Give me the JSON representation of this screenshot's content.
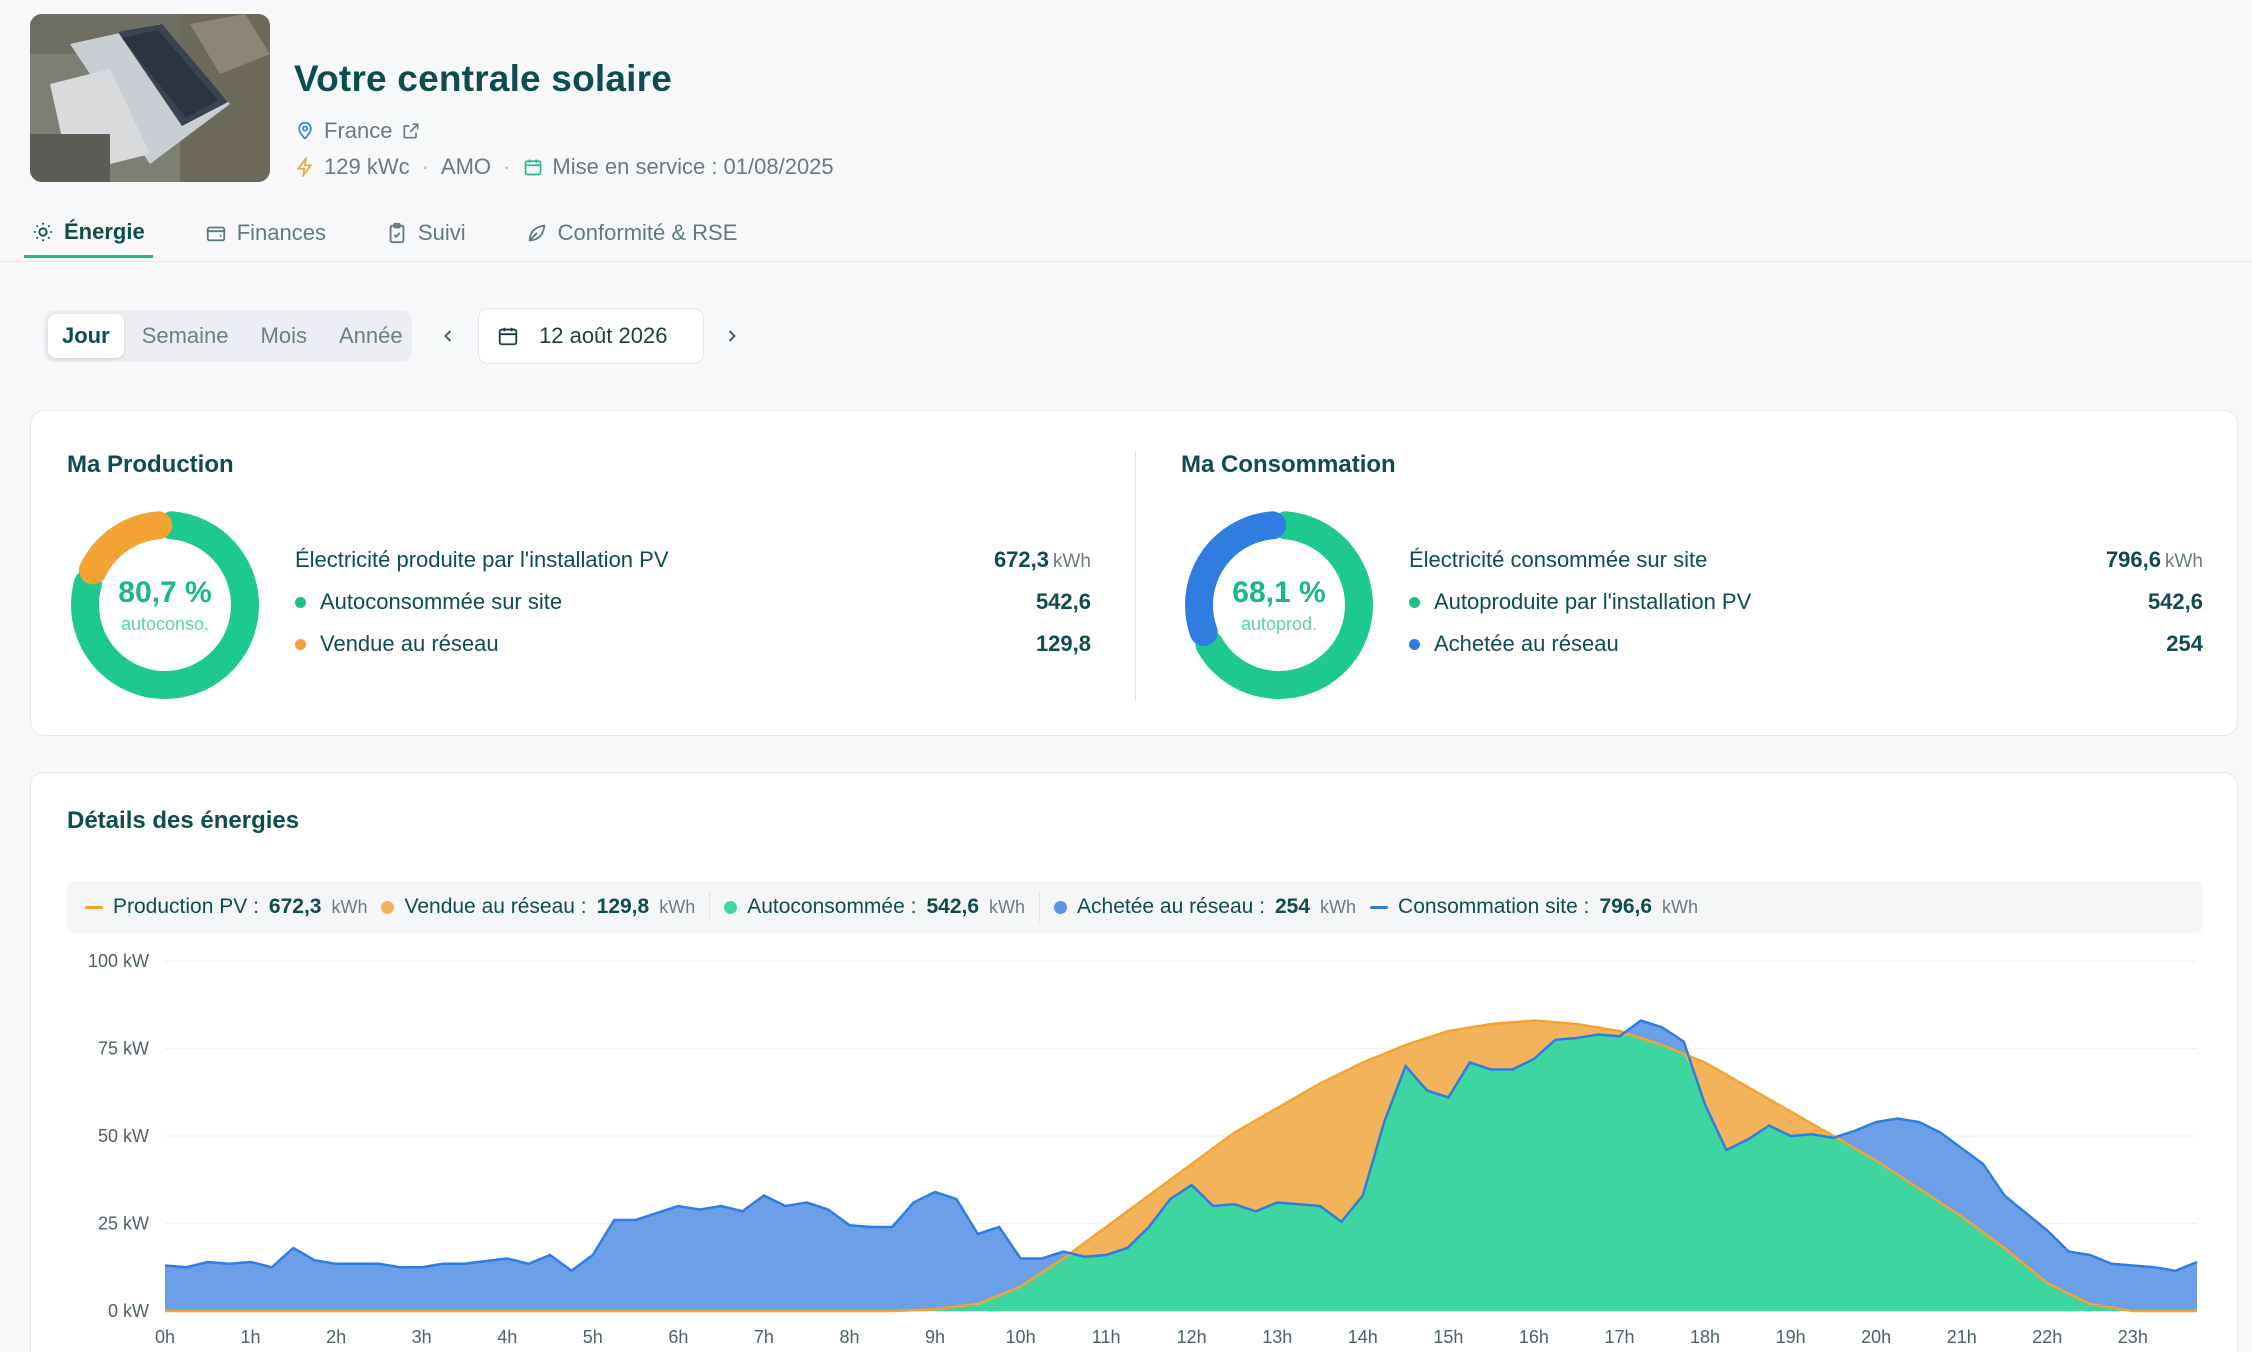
{
  "header": {
    "title": "Votre centrale solaire",
    "location": "France",
    "power": "129 kWc",
    "role": "AMO",
    "commissioning": "Mise en service : 01/08/2025"
  },
  "tabs": [
    {
      "label": "Énergie",
      "icon": "sun-icon",
      "active": true
    },
    {
      "label": "Finances",
      "icon": "wallet-icon",
      "active": false
    },
    {
      "label": "Suivi",
      "icon": "clipboard-check-icon",
      "active": false
    },
    {
      "label": "Conformité & RSE",
      "icon": "leaf-icon",
      "active": false
    }
  ],
  "period": {
    "options": [
      "Jour",
      "Semaine",
      "Mois",
      "Année"
    ],
    "selected": "Jour",
    "date": "12 août 2026"
  },
  "production": {
    "title": "Ma Production",
    "percent": "80,7 %",
    "percent_sub": "autoconso.",
    "ratio": 0.807,
    "total_label": "Électricité produite par l'installation PV",
    "total_value": "672,3",
    "total_unit": "kWh",
    "rows": [
      {
        "label": "Autoconsommée sur site",
        "value": "542,6",
        "color": "#1dbf86"
      },
      {
        "label": "Vendue au réseau",
        "value": "129,8",
        "color": "#f2a333"
      }
    ]
  },
  "consumption": {
    "title": "Ma Consommation",
    "percent": "68,1 %",
    "percent_sub": "autoprod.",
    "ratio": 0.681,
    "total_label": "Électricité consommée sur site",
    "total_value": "796,6",
    "total_unit": "kWh",
    "rows": [
      {
        "label": "Autoproduite par l'installation PV",
        "value": "542,6",
        "color": "#1dbf86"
      },
      {
        "label": "Achetée au réseau",
        "value": "254",
        "color": "#2f7de1"
      }
    ]
  },
  "details": {
    "title": "Détails des énergies",
    "legend": [
      {
        "label": "Production PV :",
        "value": "672,3",
        "unit": "kWh",
        "color": "#f2a333",
        "shape": "line"
      },
      {
        "label": "Vendue au réseau :",
        "value": "129,8",
        "unit": "kWh",
        "color": "#f2b35a",
        "shape": "dot"
      },
      {
        "label": "Autoconsommée :",
        "value": "542,6",
        "unit": "kWh",
        "color": "#3dd6a0",
        "shape": "dot"
      },
      {
        "label": "Achetée au réseau :",
        "value": "254",
        "unit": "kWh",
        "color": "#5b93e6",
        "shape": "dot"
      },
      {
        "label": "Consommation site :",
        "value": "796,6",
        "unit": "kWh",
        "color": "#2f7de1",
        "shape": "line"
      }
    ]
  },
  "chart_data": {
    "type": "area",
    "x_labels": [
      "0h",
      "1h",
      "2h",
      "3h",
      "4h",
      "5h",
      "6h",
      "7h",
      "8h",
      "9h",
      "10h",
      "11h",
      "12h",
      "13h",
      "14h",
      "15h",
      "16h",
      "17h",
      "18h",
      "19h",
      "20h",
      "21h",
      "22h",
      "23h"
    ],
    "y_ticks": [
      "0 kW",
      "25 kW",
      "50 kW",
      "75 kW",
      "100 kW"
    ],
    "ylim": [
      0,
      100
    ],
    "x_range": [
      0,
      23.75
    ],
    "grid": true,
    "series": [
      {
        "name": "Consommation site",
        "color": "#2f7de1",
        "fill": "#6b9fe8",
        "points": [
          [
            0,
            13
          ],
          [
            0.25,
            12.5
          ],
          [
            0.5,
            14
          ],
          [
            0.75,
            13.5
          ],
          [
            1,
            14
          ],
          [
            1.25,
            12.5
          ],
          [
            1.5,
            18
          ],
          [
            1.75,
            14.5
          ],
          [
            2,
            13.5
          ],
          [
            2.5,
            13.5
          ],
          [
            2.75,
            12.5
          ],
          [
            3,
            12.5
          ],
          [
            3.25,
            13.5
          ],
          [
            3.5,
            13.5
          ],
          [
            4,
            15
          ],
          [
            4.25,
            13.5
          ],
          [
            4.5,
            16
          ],
          [
            4.75,
            11.5
          ],
          [
            5,
            16
          ],
          [
            5.25,
            26
          ],
          [
            5.5,
            26
          ],
          [
            5.75,
            28
          ],
          [
            6,
            30
          ],
          [
            6.25,
            29
          ],
          [
            6.5,
            30
          ],
          [
            6.75,
            28.5
          ],
          [
            7,
            33
          ],
          [
            7.25,
            30
          ],
          [
            7.5,
            31
          ],
          [
            7.75,
            29
          ],
          [
            8,
            24.5
          ],
          [
            8.25,
            24
          ],
          [
            8.5,
            24
          ],
          [
            8.75,
            31
          ],
          [
            9,
            34
          ],
          [
            9.25,
            32
          ],
          [
            9.5,
            22
          ],
          [
            9.75,
            24
          ],
          [
            10,
            15
          ],
          [
            10.25,
            15
          ],
          [
            10.5,
            17
          ],
          [
            10.75,
            15.5
          ],
          [
            11,
            16
          ],
          [
            11.25,
            18
          ],
          [
            11.5,
            24
          ],
          [
            11.75,
            32
          ],
          [
            12,
            36
          ],
          [
            12.25,
            30
          ],
          [
            12.5,
            30.5
          ],
          [
            12.75,
            28.5
          ],
          [
            13,
            31
          ],
          [
            13.25,
            30.5
          ],
          [
            13.5,
            30
          ],
          [
            13.75,
            25.5
          ],
          [
            14,
            33
          ],
          [
            14.25,
            54
          ],
          [
            14.5,
            70
          ],
          [
            14.75,
            63
          ],
          [
            15,
            61
          ],
          [
            15.25,
            71
          ],
          [
            15.5,
            69
          ],
          [
            15.75,
            69
          ],
          [
            16,
            72
          ],
          [
            16.25,
            77.5
          ],
          [
            16.5,
            78
          ],
          [
            16.75,
            79
          ],
          [
            17,
            78.5
          ],
          [
            17.25,
            83
          ],
          [
            17.5,
            81
          ],
          [
            17.75,
            77
          ],
          [
            18,
            59
          ],
          [
            18.25,
            46
          ],
          [
            18.5,
            49
          ],
          [
            18.75,
            53
          ],
          [
            19,
            50
          ],
          [
            19.25,
            50.5
          ],
          [
            19.5,
            49.5
          ],
          [
            19.75,
            51.5
          ],
          [
            20,
            54
          ],
          [
            20.25,
            55
          ],
          [
            20.5,
            54
          ],
          [
            20.75,
            51
          ],
          [
            21,
            46.5
          ],
          [
            21.25,
            42
          ],
          [
            21.5,
            33
          ],
          [
            21.75,
            28
          ],
          [
            22,
            23
          ],
          [
            22.25,
            17
          ],
          [
            22.5,
            16
          ],
          [
            22.75,
            13.5
          ],
          [
            23,
            13
          ],
          [
            23.25,
            12.5
          ],
          [
            23.5,
            11.5
          ],
          [
            23.75,
            14
          ],
          [
            24,
            13.5
          ]
        ]
      },
      {
        "name": "Production PV",
        "color": "#f2a333",
        "fill": "#f2b35a",
        "points": [
          [
            0,
            0
          ],
          [
            8.5,
            0
          ],
          [
            9,
            0.5
          ],
          [
            9.5,
            2
          ],
          [
            10,
            7
          ],
          [
            10.5,
            15
          ],
          [
            11,
            24
          ],
          [
            11.5,
            33
          ],
          [
            12,
            42
          ],
          [
            12.5,
            51
          ],
          [
            13,
            58
          ],
          [
            13.5,
            65
          ],
          [
            14,
            71
          ],
          [
            14.5,
            76
          ],
          [
            15,
            80
          ],
          [
            15.5,
            82
          ],
          [
            16,
            83
          ],
          [
            16.5,
            82
          ],
          [
            17,
            80
          ],
          [
            17.5,
            76
          ],
          [
            18,
            71
          ],
          [
            18.5,
            64
          ],
          [
            19,
            57
          ],
          [
            19.5,
            50
          ],
          [
            20,
            43
          ],
          [
            20.5,
            35
          ],
          [
            21,
            27
          ],
          [
            21.5,
            18
          ],
          [
            22,
            8
          ],
          [
            22.5,
            2
          ],
          [
            23,
            0
          ],
          [
            24,
            0
          ]
        ]
      },
      {
        "name": "Autoconsommée",
        "color": "#2fcf95",
        "fill": "#3dd6a0"
      }
    ]
  }
}
